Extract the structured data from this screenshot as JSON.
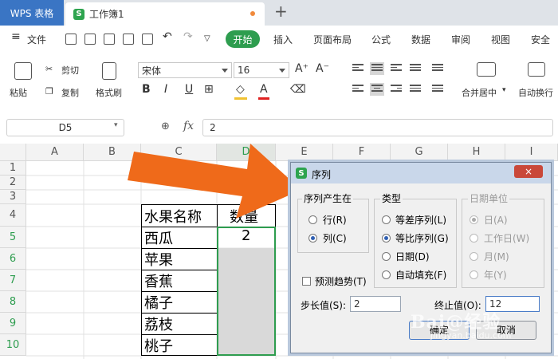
{
  "titlebar": {
    "app_tab": "WPS 表格",
    "doc_tab": "工作簿1",
    "doc_logo": "S",
    "new_tab": "+"
  },
  "menubar": {
    "file": "文件",
    "tabs": [
      "开始",
      "插入",
      "页面布局",
      "公式",
      "数据",
      "审阅",
      "视图",
      "安全"
    ]
  },
  "ribbon": {
    "paste": "粘贴",
    "cut": "剪切",
    "copy": "复制",
    "format_painter": "格式刷",
    "font_name": "宋体",
    "font_size": "16",
    "bold": "B",
    "italic": "I",
    "underline": "U",
    "font_color": "A",
    "merge": "合并居中",
    "wrap": "自动换行",
    "grow": "A⁺",
    "shrink": "A⁻"
  },
  "formula_bar": {
    "name_box": "D5",
    "fx": "fx",
    "value": "2"
  },
  "sheet": {
    "columns": [
      "A",
      "B",
      "C",
      "D",
      "E",
      "F",
      "G",
      "H",
      "I"
    ],
    "rows": [
      "1",
      "2",
      "3",
      "4",
      "5",
      "6",
      "7",
      "8",
      "9",
      "10"
    ],
    "header_name": "水果名称",
    "header_qty": "数量",
    "fruits": [
      "西瓜",
      "苹果",
      "香蕉",
      "橘子",
      "荔枝",
      "桃子"
    ],
    "first_qty": "2"
  },
  "dialog": {
    "title": "序列",
    "logo": "S",
    "close": "×",
    "series_in_label": "序列产生在",
    "series_in_options": [
      "行(R)",
      "列(C)"
    ],
    "type_label": "类型",
    "type_options": [
      "等差序列(L)",
      "等比序列(G)",
      "日期(D)",
      "自动填充(F)"
    ],
    "date_unit_label": "日期单位",
    "date_unit_options": [
      "日(A)",
      "工作日(W)",
      "月(M)",
      "年(Y)"
    ],
    "trend_label": "预测趋势(T)",
    "step_label": "步长值(S):",
    "step_value": "2",
    "stop_label": "终止值(O):",
    "stop_value": "12",
    "ok": "确定",
    "cancel": "取消"
  },
  "watermark": {
    "text": "Bai@经验",
    "sub": "jingyan.baidu.com"
  },
  "colors": {
    "accent_green": "#2e9d4f",
    "arrow_orange": "#ef6a1a",
    "wps_blue": "#3a75c4"
  }
}
